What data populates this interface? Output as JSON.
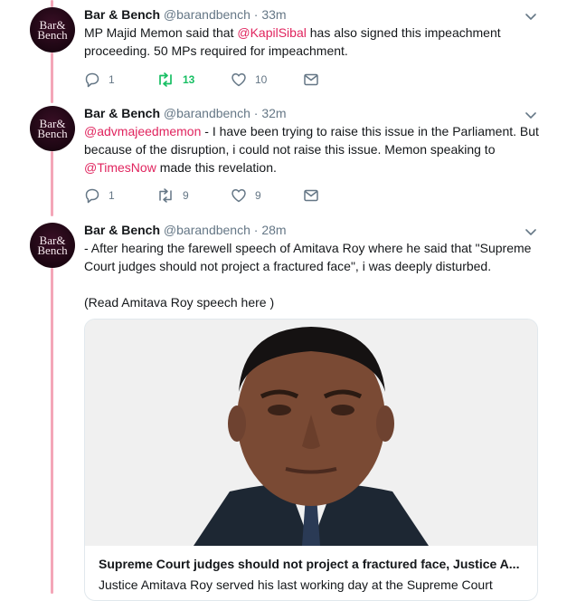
{
  "tweets": [
    {
      "author": "Bar & Bench",
      "handle": "@barandbench",
      "separator": "·",
      "time": "33m",
      "text_parts": [
        "MP Majid Memon said that ",
        "@KapilSibal",
        " has also signed this impeachment proceeding. 50 MPs required for impeachment."
      ],
      "replies": "1",
      "retweets": "13",
      "likes": "10"
    },
    {
      "author": "Bar & Bench",
      "handle": "@barandbench",
      "separator": "·",
      "time": "32m",
      "text_parts": [
        "@advmajeedmemon",
        " - I have been trying to raise this issue in the Parliament. But because of the disruption, i could not raise this issue. Memon speaking to ",
        "@TimesNow",
        " made this revelation."
      ],
      "replies": "1",
      "retweets": "9",
      "likes": "9"
    },
    {
      "author": "Bar & Bench",
      "handle": "@barandbench",
      "separator": "·",
      "time": "28m",
      "text_lines": [
        "- After hearing the farewell speech of Amitava Roy where he said that \"Supreme Court judges should not project a fractured face\", i was deeply disturbed.",
        "(Read Amitava Roy speech here )"
      ],
      "card": {
        "title": "Supreme Court judges should not project a fractured face, Justice A...",
        "description": "Justice Amitava Roy served his last working day at the Supreme Court"
      }
    }
  ],
  "avatar": {
    "line1": "Bar&",
    "line2": "Bench"
  },
  "icons": [
    "reply-icon",
    "retweet-icon",
    "like-icon",
    "direct-message-icon",
    "caret-down-icon"
  ],
  "colors": {
    "link": "#e0245e",
    "thread": "#f4a6b8",
    "retweet_active": "#17bf63",
    "muted": "#657786"
  }
}
